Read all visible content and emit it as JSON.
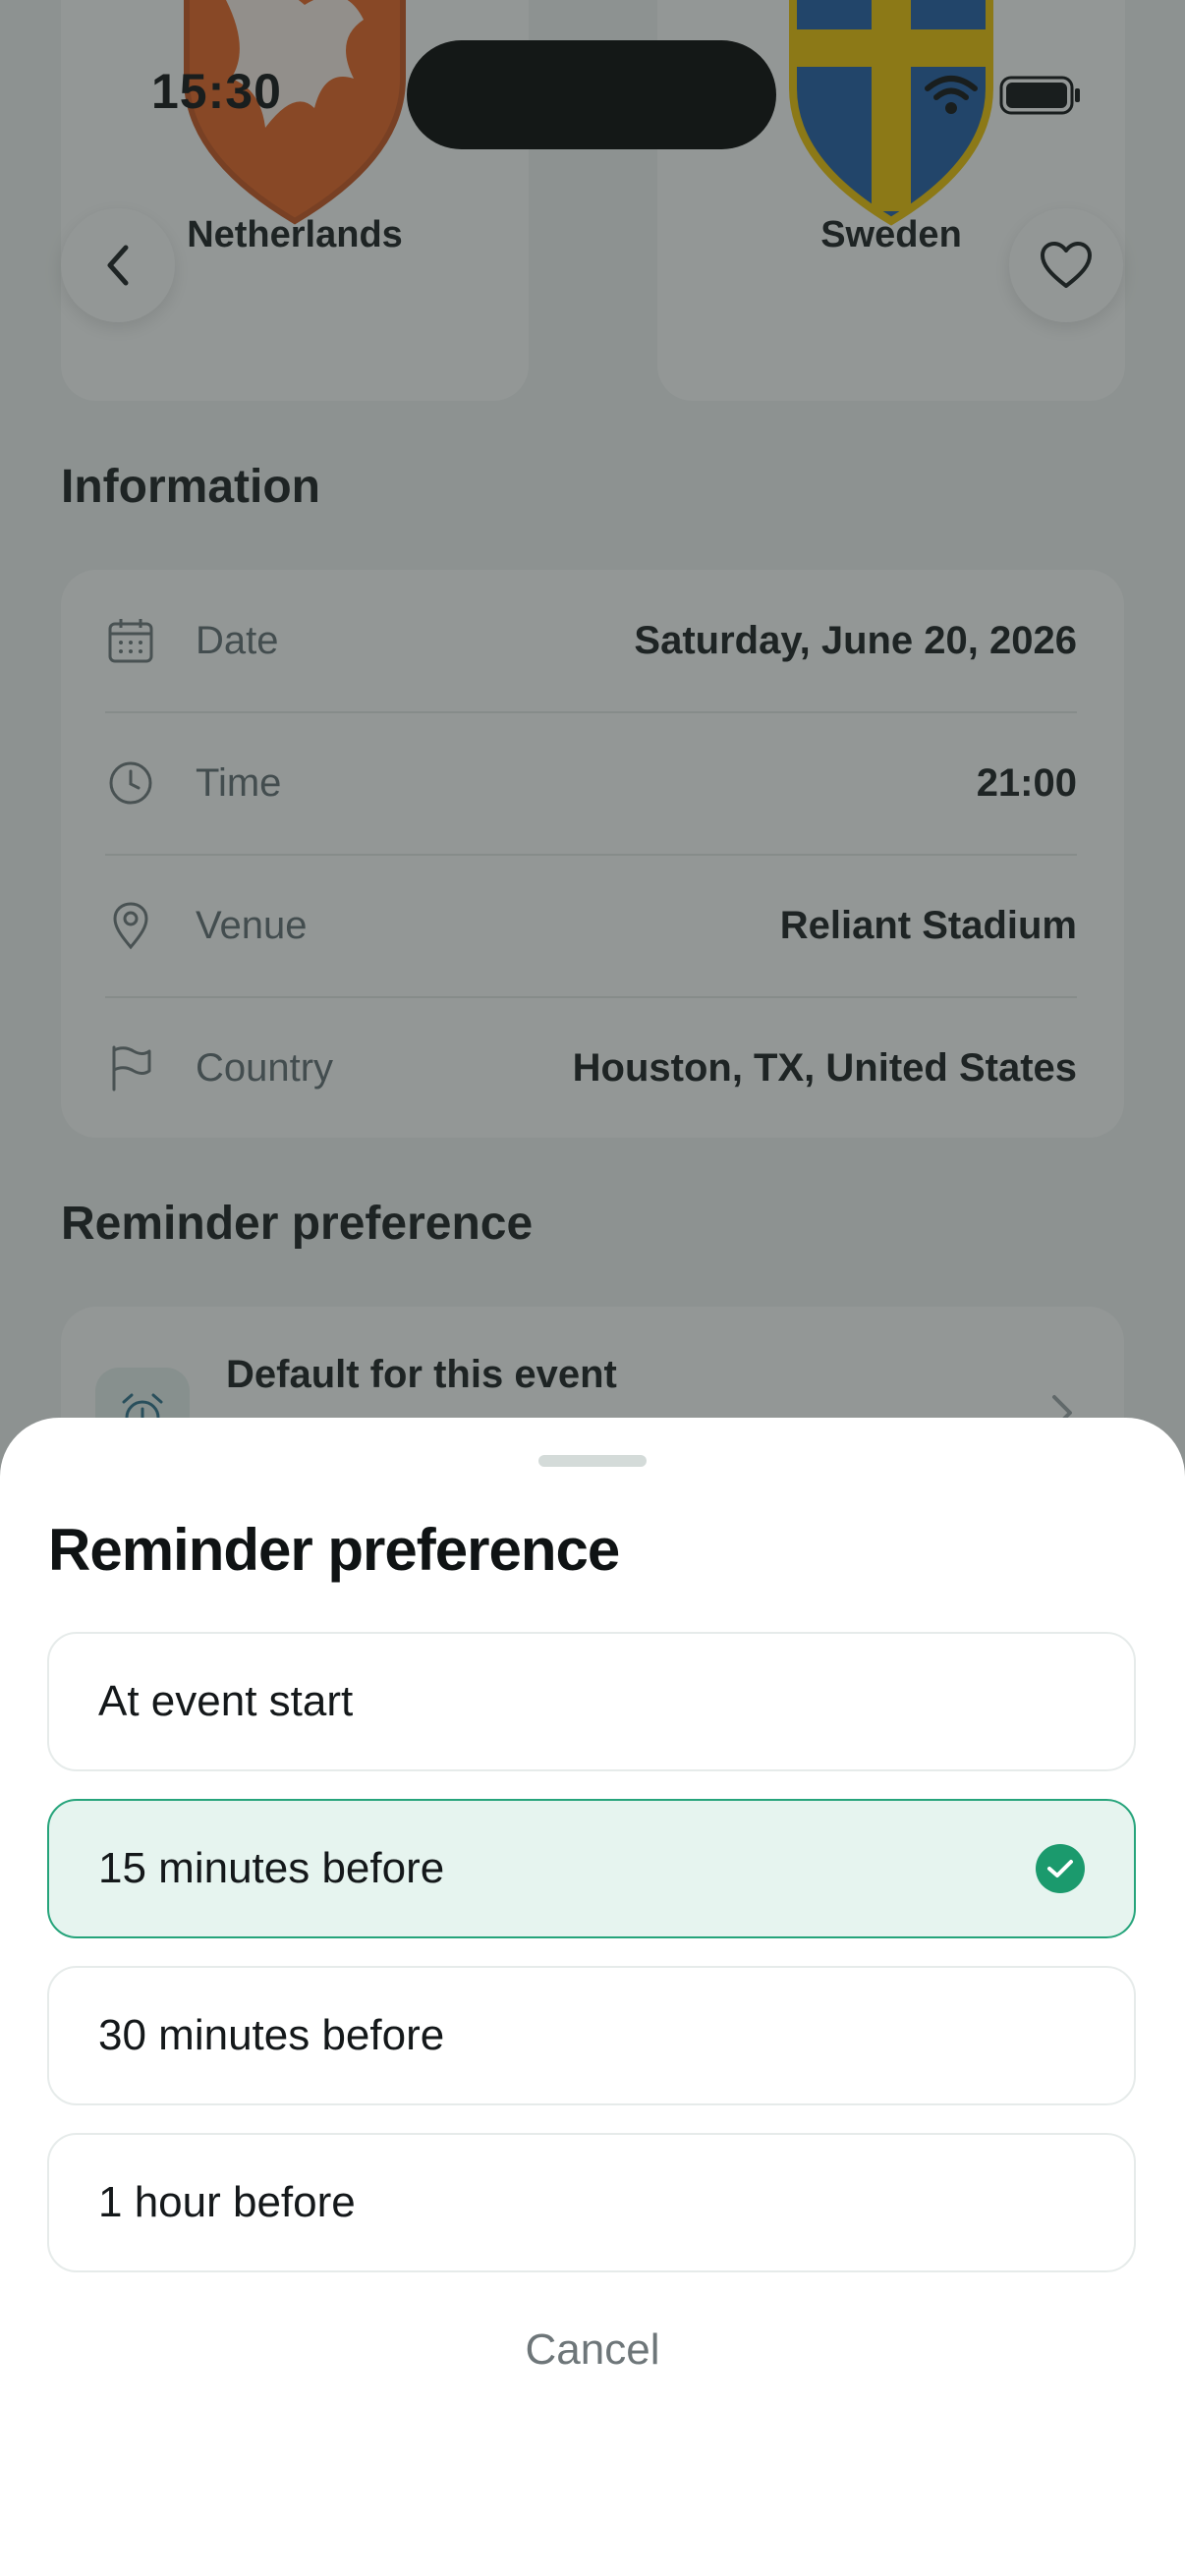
{
  "status_bar": {
    "time": "15:30"
  },
  "teams": {
    "home": {
      "name": "Netherlands",
      "crest": "lion-crest-icon",
      "color": "#e8611f"
    },
    "away": {
      "name": "Sweden",
      "crest": "cross-crest-icon",
      "color": "#f0c300"
    }
  },
  "header": {
    "back": "back-chevron-icon",
    "favorite": "heart-icon"
  },
  "information": {
    "title": "Information",
    "rows": [
      {
        "icon": "calendar-icon",
        "label": "Date",
        "value": "Saturday, June 20, 2026"
      },
      {
        "icon": "clock-icon",
        "label": "Time",
        "value": "21:00"
      },
      {
        "icon": "location-pin-icon",
        "label": "Venue",
        "value": "Reliant Stadium"
      },
      {
        "icon": "flag-icon",
        "label": "Country",
        "value": "Houston, TX, United States"
      }
    ]
  },
  "reminder_section": {
    "title": "Reminder preference",
    "card_title": "Default for this event",
    "icon": "alarm-clock-icon"
  },
  "sheet": {
    "title": "Reminder preference",
    "options": [
      {
        "label": "At event start",
        "selected": false
      },
      {
        "label": "15 minutes before",
        "selected": true
      },
      {
        "label": "30 minutes before",
        "selected": false
      },
      {
        "label": "1 hour before",
        "selected": false
      }
    ],
    "cancel": "Cancel"
  },
  "colors": {
    "accent": "#1b9a6d",
    "selected_bg": "#e6f4ef"
  }
}
